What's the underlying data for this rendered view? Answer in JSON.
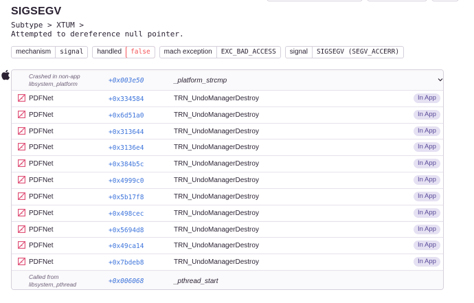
{
  "header": {
    "title": "SIGSEGV",
    "subtype": "Subtype > XTUM >",
    "message": "Attempted to dereference null pointer."
  },
  "tags": [
    {
      "key": "mechanism",
      "value": "signal",
      "error": false
    },
    {
      "key": "handled",
      "value": "false",
      "error": true
    },
    {
      "key": "mach exception",
      "value": "EXC_BAD_ACCESS",
      "error": false
    },
    {
      "key": "signal",
      "value": "SIGSEGV (SEGV_ACCERR)",
      "error": false
    }
  ],
  "stacktrace": {
    "platform_icon": "apple-logo-icon",
    "crash_frame": {
      "label_line1": "Crashed in non-app",
      "label_line2": "libsystem_platform",
      "address": "+0x003e50",
      "function": "_platform_strcmp",
      "toggle_icon": "chevron-down-icon"
    },
    "in_app_badge": "In App",
    "frames": [
      {
        "package": "PDFNet",
        "address": "+0x334584",
        "function": "TRN_UndoManagerDestroy"
      },
      {
        "package": "PDFNet",
        "address": "+0x6d51a0",
        "function": "TRN_UndoManagerDestroy"
      },
      {
        "package": "PDFNet",
        "address": "+0x313644",
        "function": "TRN_UndoManagerDestroy"
      },
      {
        "package": "PDFNet",
        "address": "+0x3136e4",
        "function": "TRN_UndoManagerDestroy"
      },
      {
        "package": "PDFNet",
        "address": "+0x384b5c",
        "function": "TRN_UndoManagerDestroy"
      },
      {
        "package": "PDFNet",
        "address": "+0x4999c0",
        "function": "TRN_UndoManagerDestroy"
      },
      {
        "package": "PDFNet",
        "address": "+0x5b17f8",
        "function": "TRN_UndoManagerDestroy"
      },
      {
        "package": "PDFNet",
        "address": "+0x498cec",
        "function": "TRN_UndoManagerDestroy"
      },
      {
        "package": "PDFNet",
        "address": "+0x5694d8",
        "function": "TRN_UndoManagerDestroy"
      },
      {
        "package": "PDFNet",
        "address": "+0x49ca14",
        "function": "TRN_UndoManagerDestroy"
      },
      {
        "package": "PDFNet",
        "address": "+0x7bdeb8",
        "function": "TRN_UndoManagerDestroy"
      }
    ],
    "called_from": {
      "label_line1": "Called from",
      "label_line2": "libsystem_pthread",
      "address": "+0x006068",
      "function": "_pthread_start"
    },
    "package_icon": "image-missing-icon",
    "colors": {
      "address": "#3d74db",
      "error": "#f55459",
      "badge_bg": "#e5e0f2",
      "package_icon": "#e1567c"
    }
  }
}
